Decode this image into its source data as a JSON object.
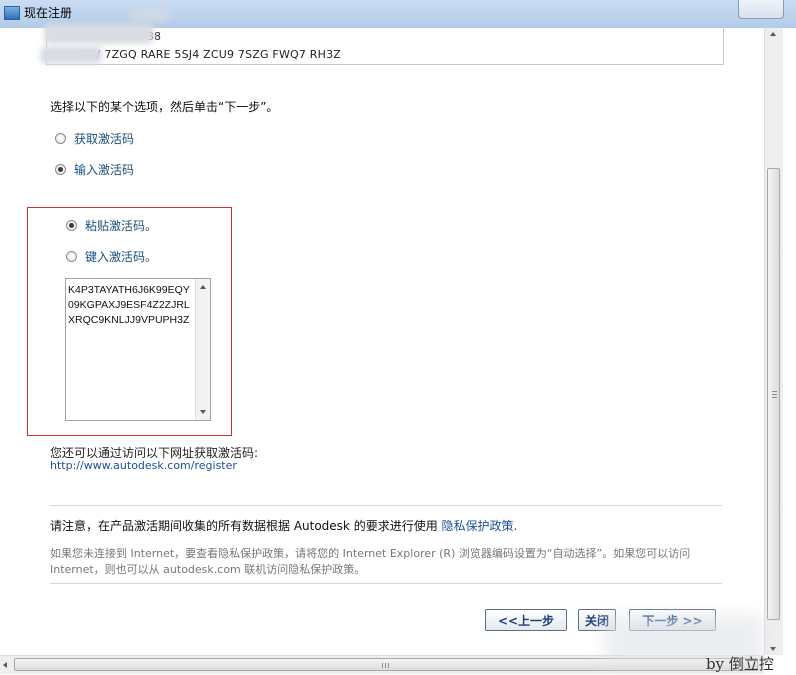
{
  "window": {
    "title": "现在注册"
  },
  "license": {
    "line1": "38",
    "line2": "JEW 7ZGQ RARE 5SJ4 ZCU9 7SZG FWQ7 RH3Z"
  },
  "instruction": "选择以下的某个选项，然后单击“下一步”。",
  "options": {
    "get_code": "获取激活码",
    "enter_code": "输入激活码",
    "paste_code": "粘贴激活码。",
    "type_code": "键入激活码。"
  },
  "activation_code": "K4P3TAYATH6J6K99EQY09KGPAXJ9ESF4Z2ZJRLXRQC9KNLJJ9VPUPH3Z",
  "access": {
    "text": "您还可以通过访问以下网址获取激活码:",
    "url": "http://www.autodesk.com/register"
  },
  "notice": {
    "prefix": "请注意，在产品激活期间收集的所有数据根据 Autodesk 的要求进行使用 ",
    "link": "隐私保护政策.",
    "grey": "如果您未连接到 Internet，要查看隐私保护政策，请将您的 Internet Explorer (R) 浏览器编码设置为“自动选择”。如果您可以访问 Internet，则也可以从 autodesk.com 联机访问隐私保护政策。"
  },
  "buttons": {
    "back": "<<上一步",
    "close": "关闭",
    "next": "下一步 >>"
  },
  "watermark": "by 倒立控",
  "colors": {
    "link": "#1b4f9a",
    "frame": "#c8342b",
    "title_bar": "#b3cbe8"
  }
}
